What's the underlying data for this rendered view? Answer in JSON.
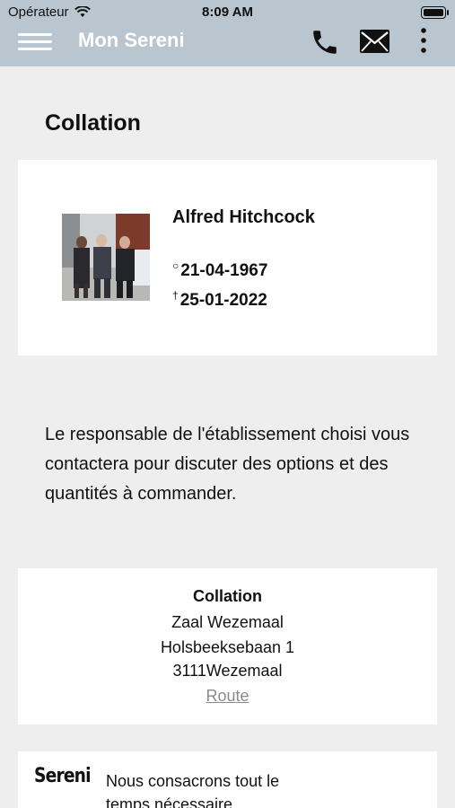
{
  "status": {
    "carrier": "Opérateur",
    "time": "8:09 AM"
  },
  "appbar": {
    "title": "Mon Sereni"
  },
  "page": {
    "title": "Collation"
  },
  "deceased": {
    "name": "Alfred Hitchcock",
    "birth_symbol": "○",
    "birth_date": "21-04-1967",
    "death_symbol": "†",
    "death_date": "25-01-2022"
  },
  "info": {
    "text": "Le responsable de l'établissement choisi vous contactera pour discuter des options et des quantités à commander."
  },
  "location": {
    "title": "Collation",
    "venue": "Zaal Wezemaal",
    "street": "Holsbeeksebaan 1",
    "city": "3111Wezemaal",
    "route_label": "Route"
  },
  "promo": {
    "logo": "Sereni",
    "text": "Nous consacrons tout le temps nécessaire"
  },
  "colors": {
    "appbar": "#b9c6cf",
    "background": "#eeeeee",
    "card": "#ffffff",
    "link": "#8a8a8a"
  }
}
